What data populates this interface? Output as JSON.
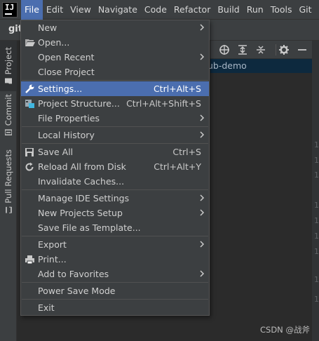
{
  "menubar": {
    "items": [
      {
        "label": "File",
        "active": true
      },
      {
        "label": "Edit"
      },
      {
        "label": "View"
      },
      {
        "label": "Navigate"
      },
      {
        "label": "Code"
      },
      {
        "label": "Refactor"
      },
      {
        "label": "Build"
      },
      {
        "label": "Run"
      },
      {
        "label": "Tools"
      },
      {
        "label": "Git"
      }
    ]
  },
  "navbar": {
    "project_name": "git"
  },
  "left_strip": {
    "tabs": [
      {
        "label": "Project",
        "icon": "folder-icon"
      },
      {
        "label": "Commit",
        "icon": "commit-icon"
      },
      {
        "label": "Pull Requests",
        "icon": "pull-request-icon"
      }
    ]
  },
  "project_tree": {
    "selected_label": "ub-demo"
  },
  "gutter": {
    "numbers": [
      "1",
      "1",
      "1",
      "1",
      "1",
      "1",
      "1",
      "1",
      "1"
    ]
  },
  "watermark": "CSDN @战斧",
  "file_menu": {
    "items": [
      {
        "label": "New",
        "submenu": true
      },
      {
        "label": "Open...",
        "icon": "folder-open-icon"
      },
      {
        "label": "Open Recent",
        "submenu": true
      },
      {
        "label": "Close Project"
      },
      {
        "label": "Settings...",
        "shortcut": "Ctrl+Alt+S",
        "icon": "wrench-icon",
        "highlighted": true
      },
      {
        "label": "Project Structure...",
        "shortcut": "Ctrl+Alt+Shift+S",
        "icon": "project-structure-icon"
      },
      {
        "label": "File Properties",
        "submenu": true
      },
      {
        "label": "Local History",
        "submenu": true
      },
      {
        "label": "Save All",
        "shortcut": "Ctrl+S",
        "icon": "save-icon"
      },
      {
        "label": "Reload All from Disk",
        "shortcut": "Ctrl+Alt+Y",
        "icon": "reload-icon"
      },
      {
        "label": "Invalidate Caches..."
      },
      {
        "label": "Manage IDE Settings",
        "submenu": true
      },
      {
        "label": "New Projects Setup",
        "submenu": true
      },
      {
        "label": "Save File as Template..."
      },
      {
        "label": "Export",
        "submenu": true
      },
      {
        "label": "Print...",
        "icon": "printer-icon"
      },
      {
        "label": "Add to Favorites",
        "submenu": true
      },
      {
        "label": "Power Save Mode"
      },
      {
        "label": "Exit"
      }
    ]
  },
  "colors": {
    "menu_highlight": "#4b6eaf",
    "panel_bg": "#3c3f41",
    "editor_bg": "#2b2b2b"
  }
}
